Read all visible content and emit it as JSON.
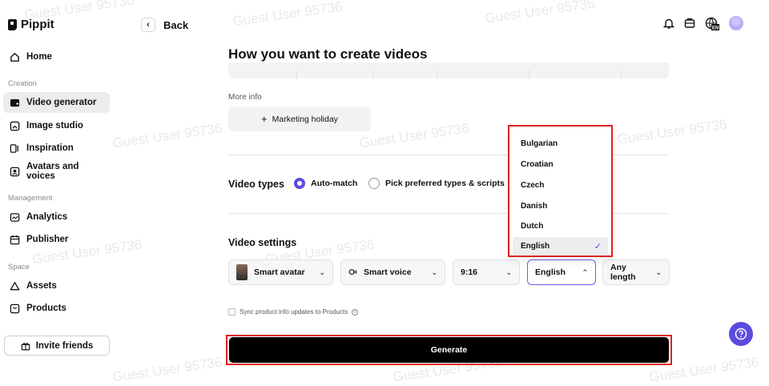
{
  "app": {
    "name": "Pippit",
    "back_label": "Back"
  },
  "watermark": "Guest User 95736",
  "header_icons": [
    "bell-icon",
    "inbox-icon",
    "language-icon",
    "avatar"
  ],
  "sidebar": {
    "items": [
      {
        "label": "Home",
        "icon": "home-icon"
      },
      {
        "label": "Video generator",
        "icon": "video-generator-icon",
        "active": true
      },
      {
        "label": "Image studio",
        "icon": "image-studio-icon"
      },
      {
        "label": "Inspiration",
        "icon": "inspiration-icon"
      },
      {
        "label": "Avatars and voices",
        "icon": "avatar-voice-icon"
      },
      {
        "label": "Analytics",
        "icon": "analytics-icon"
      },
      {
        "label": "Publisher",
        "icon": "calendar-icon"
      },
      {
        "label": "Assets",
        "icon": "assets-icon"
      },
      {
        "label": "Products",
        "icon": "products-icon"
      }
    ],
    "sections": {
      "creation": "Creation",
      "management": "Management",
      "space": "Space"
    },
    "invite_label": "Invite friends"
  },
  "main": {
    "title": "How you want to create videos",
    "more_info_label": "More info",
    "chip_label": "Marketing holiday",
    "video_types": {
      "label": "Video types",
      "options": [
        {
          "label": "Auto-match",
          "selected": true
        },
        {
          "label": "Pick preferred types & scripts",
          "selected": false
        }
      ]
    },
    "video_settings": {
      "label": "Video settings",
      "avatar": "Smart avatar",
      "voice": "Smart voice",
      "ratio": "9:16",
      "language": "English",
      "length": "Any length"
    },
    "sync_label": "Sync product info updates to Products",
    "generate_label": "Generate"
  },
  "language_dropdown": {
    "options": [
      "Bulgarian",
      "Croatian",
      "Czech",
      "Danish",
      "Dutch",
      "English"
    ],
    "selected": "English"
  },
  "colors": {
    "accent": "#5b4bdf",
    "highlight": "#e02020"
  }
}
